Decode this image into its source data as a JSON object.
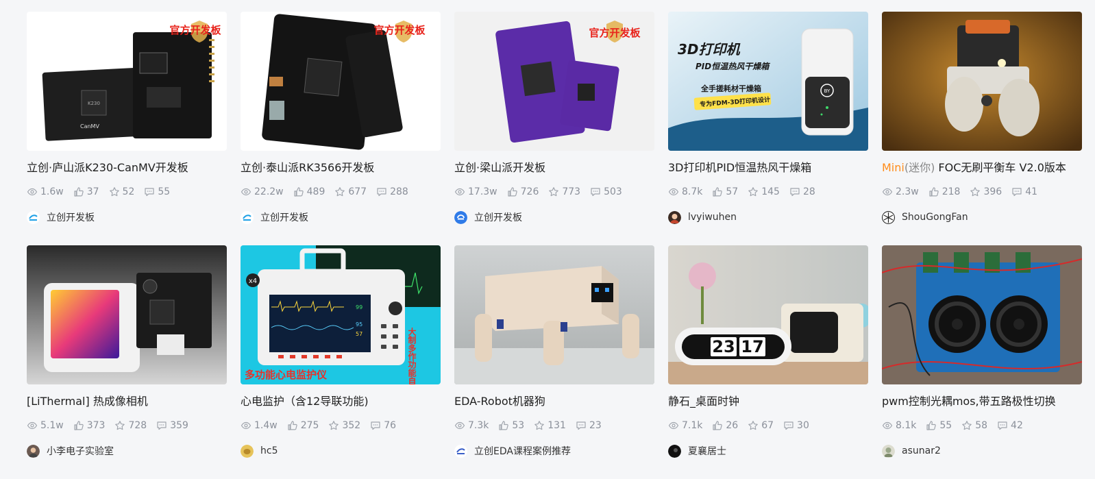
{
  "cards": [
    {
      "title": "立创·庐山派K230-CanMV开发板",
      "views": "1.6w",
      "likes": "37",
      "stars": "52",
      "comments": "55",
      "author": "立创开发板",
      "badge": "官方开发板",
      "chip_text": "K230",
      "brand_text": "CanMV"
    },
    {
      "title": "立创·泰山派RK3566开发板",
      "views": "22.2w",
      "likes": "489",
      "stars": "677",
      "comments": "288",
      "author": "立创开发板",
      "badge": "官方开发板"
    },
    {
      "title": "立创·梁山派开发板",
      "views": "17.3w",
      "likes": "726",
      "stars": "773",
      "comments": "503",
      "author": "立创开发板",
      "badge": "官方开发板"
    },
    {
      "title": "3D打印机PID恒温热风干燥箱",
      "views": "8.7k",
      "likes": "57",
      "stars": "145",
      "comments": "28",
      "author": "lvyiwuhen",
      "poster": {
        "line1": "3D打印机",
        "line2": "PID恒温热风干燥箱",
        "line3": "全手搓耗材干燥箱",
        "line4": "专为FDM-3D打印机设计",
        "device_label": "BY"
      }
    },
    {
      "title_hl": "Mini",
      "title_paren": "(迷你)",
      "title_rest": " FOC无刷平衡车 V2.0版本",
      "views": "2.3w",
      "likes": "218",
      "stars": "396",
      "comments": "41",
      "author": "ShouGongFan"
    },
    {
      "title": "[LiThermal] 热成像相机",
      "views": "5.1w",
      "likes": "373",
      "stars": "728",
      "comments": "359",
      "author": "小李电子实验室"
    },
    {
      "title": "心电监护（含12导联功能)",
      "views": "1.4w",
      "likes": "275",
      "stars": "352",
      "comments": "76",
      "author": "hc5",
      "poster": {
        "caption": "多功能心电监护仪",
        "zoom": "x4",
        "side_text": "大制多作功能自制",
        "screen_values": [
          "99",
          "95",
          "57"
        ]
      }
    },
    {
      "title": "EDA-Robot机器狗",
      "views": "7.3k",
      "likes": "53",
      "stars": "131",
      "comments": "23",
      "author": "立创EDA课程案例推荐"
    },
    {
      "title": "静石_桌面时钟",
      "views": "7.1k",
      "likes": "26",
      "stars": "67",
      "comments": "30",
      "author": "夏襄居士",
      "clock": {
        "hour": "23",
        "minute": "17"
      }
    },
    {
      "title": "pwm控制光耦mos,带五路极性切换",
      "views": "8.1k",
      "likes": "55",
      "stars": "58",
      "comments": "42",
      "author": "asunar2"
    }
  ],
  "colors": {
    "accent": "#ff8c1a",
    "stat_gray": "#8a8f99",
    "badge_red": "#e8231b"
  }
}
